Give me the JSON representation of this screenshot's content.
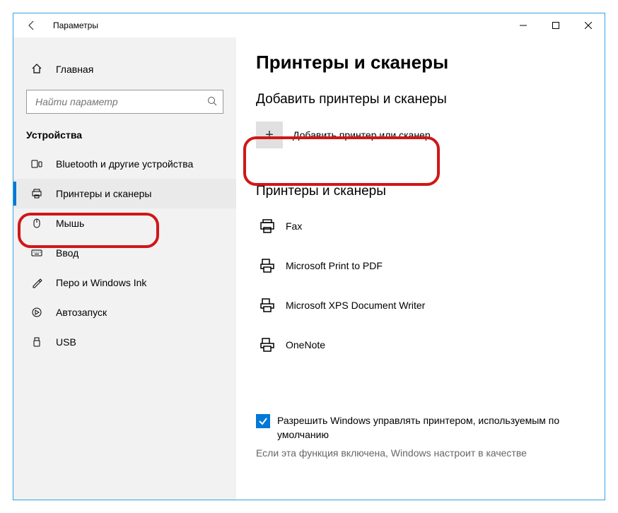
{
  "titlebar": {
    "title": "Параметры"
  },
  "sidebar": {
    "home_label": "Главная",
    "search_placeholder": "Найти параметр",
    "section_label": "Устройства",
    "items": [
      {
        "label": "Bluetooth и другие устройства"
      },
      {
        "label": "Принтеры и сканеры"
      },
      {
        "label": "Мышь"
      },
      {
        "label": "Ввод"
      },
      {
        "label": "Перо и Windows Ink"
      },
      {
        "label": "Автозапуск"
      },
      {
        "label": "USB"
      }
    ]
  },
  "main": {
    "page_title": "Принтеры и сканеры",
    "add_group_title": "Добавить принтеры и сканеры",
    "add_button_label": "Добавить принтер или сканер",
    "list_group_title": "Принтеры и сканеры",
    "printers": [
      {
        "label": "Fax"
      },
      {
        "label": "Microsoft Print to PDF"
      },
      {
        "label": "Microsoft XPS Document Writer"
      },
      {
        "label": "OneNote"
      }
    ],
    "checkbox_label": "Разрешить Windows управлять принтером, используемым по умолчанию",
    "checkbox_hint": "Если эта функция включена, Windows настроит в качестве"
  }
}
